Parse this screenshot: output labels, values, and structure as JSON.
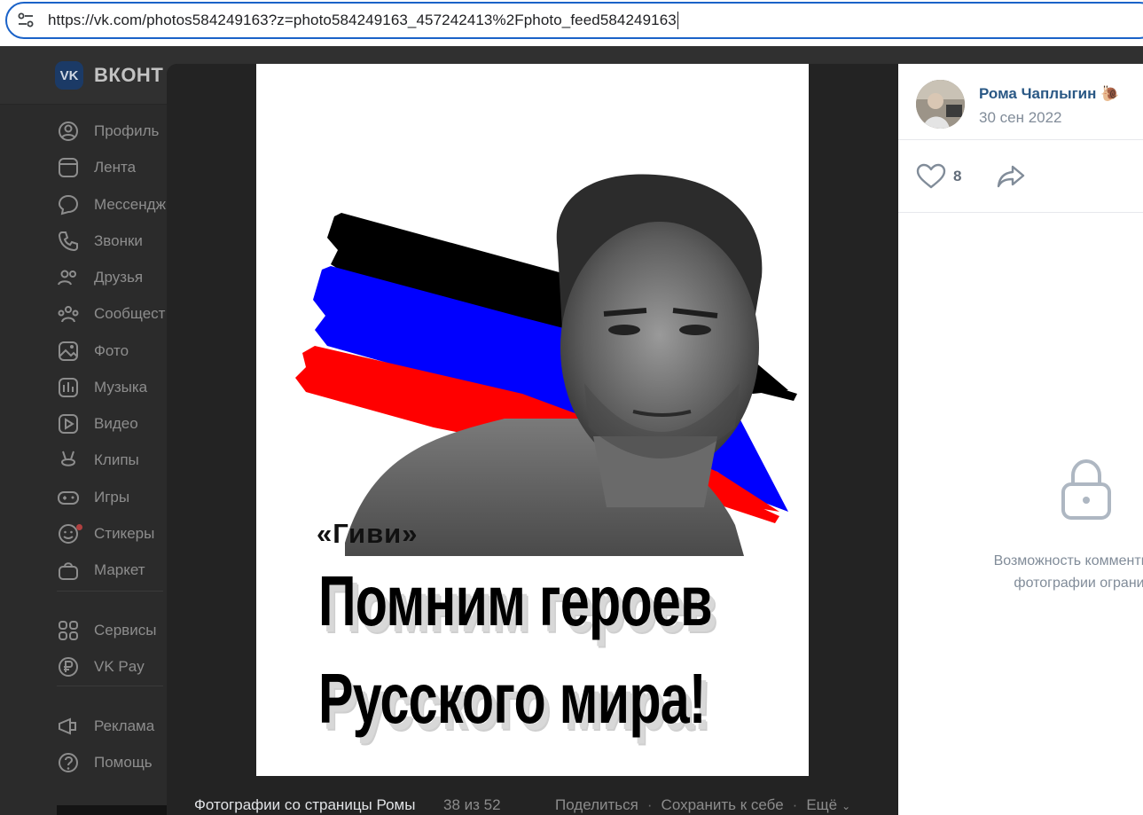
{
  "browser": {
    "url": "https://vk.com/photos584249163?z=photo584249163_457242413%2Fphoto_feed584249163"
  },
  "vk": {
    "logo_text": "VK",
    "brand": "ВКОНТ",
    "sidebar": [
      {
        "label": "Профиль",
        "icon": "profile-icon"
      },
      {
        "label": "Лента",
        "icon": "feed-icon"
      },
      {
        "label": "Мессендж",
        "icon": "messenger-icon"
      },
      {
        "label": "Звонки",
        "icon": "phone-icon"
      },
      {
        "label": "Друзья",
        "icon": "friends-icon"
      },
      {
        "label": "Сообщест",
        "icon": "communities-icon"
      },
      {
        "label": "Фото",
        "icon": "photo-icon"
      },
      {
        "label": "Музыка",
        "icon": "music-icon"
      },
      {
        "label": "Видео",
        "icon": "video-icon"
      },
      {
        "label": "Клипы",
        "icon": "clips-icon"
      },
      {
        "label": "Игры",
        "icon": "games-icon"
      },
      {
        "label": "Стикеры",
        "icon": "stickers-icon"
      },
      {
        "label": "Маркет",
        "icon": "market-icon"
      },
      {
        "label": "Сервисы",
        "icon": "services-icon"
      },
      {
        "label": "VK Pay",
        "icon": "vkpay-icon"
      },
      {
        "label": "Реклама",
        "icon": "ads-icon"
      },
      {
        "label": "Помощь",
        "icon": "help-icon"
      }
    ]
  },
  "viewer": {
    "poster": {
      "caption": "«Гиви»",
      "line1": "Помним героев",
      "line2": "Русского мира!",
      "flag_colors": [
        "#000000",
        "#0000ff",
        "#ff0000"
      ]
    },
    "footer": {
      "album": "Фотографии со страницы Ромы",
      "count": "38 из 52",
      "share": "Поделиться",
      "save": "Сохранить к себе",
      "more": "Ещё"
    },
    "panel": {
      "author_name": "Рома Чаплыгин 🐌",
      "date": "30 сен 2022",
      "likes": "8",
      "comments_note_line1": "Возможность комментиро",
      "comments_note_line2": "фотографии ограни"
    }
  },
  "colors": {
    "accent": "#2a5885",
    "url_border": "#1a62c8",
    "muted": "#818c99"
  }
}
